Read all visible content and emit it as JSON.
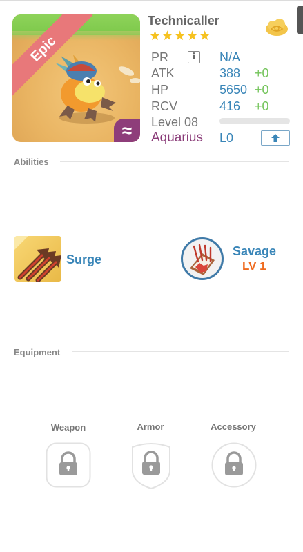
{
  "monster": {
    "name": "Technicaller",
    "rarity": "Epic",
    "stars": "★★★★★",
    "element_symbol": "≈",
    "zodiac": "Aquarius",
    "l_value": "L0"
  },
  "stats": {
    "pr_label": "PR",
    "pr_info": "i",
    "pr_value": "N/A",
    "atk_label": "ATK",
    "atk_value": "388",
    "atk_bonus": "+0",
    "hp_label": "HP",
    "hp_value": "5650",
    "hp_bonus": "+0",
    "rcv_label": "RCV",
    "rcv_value": "416",
    "rcv_bonus": "+0",
    "level_label": "Level 08",
    "level_progress": 0
  },
  "abilities": {
    "title": "Abilities",
    "items": [
      {
        "name": "Surge",
        "icon": "surge-arrows-icon"
      },
      {
        "name": "Savage",
        "level": "LV 1",
        "icon": "savage-claw-icon"
      }
    ]
  },
  "equipment": {
    "title": "Equipment",
    "slots": [
      {
        "label": "Weapon",
        "icon": "lock-icon"
      },
      {
        "label": "Armor",
        "icon": "lock-icon"
      },
      {
        "label": "Accessory",
        "icon": "lock-icon"
      }
    ]
  },
  "colors": {
    "accent_blue": "#3a86b8",
    "bonus_green": "#73c45a",
    "zodiac_purple": "#8a3b78",
    "epic_red": "#e8787a",
    "star_gold": "#f6c21f",
    "level_orange": "#ef6a1e"
  }
}
